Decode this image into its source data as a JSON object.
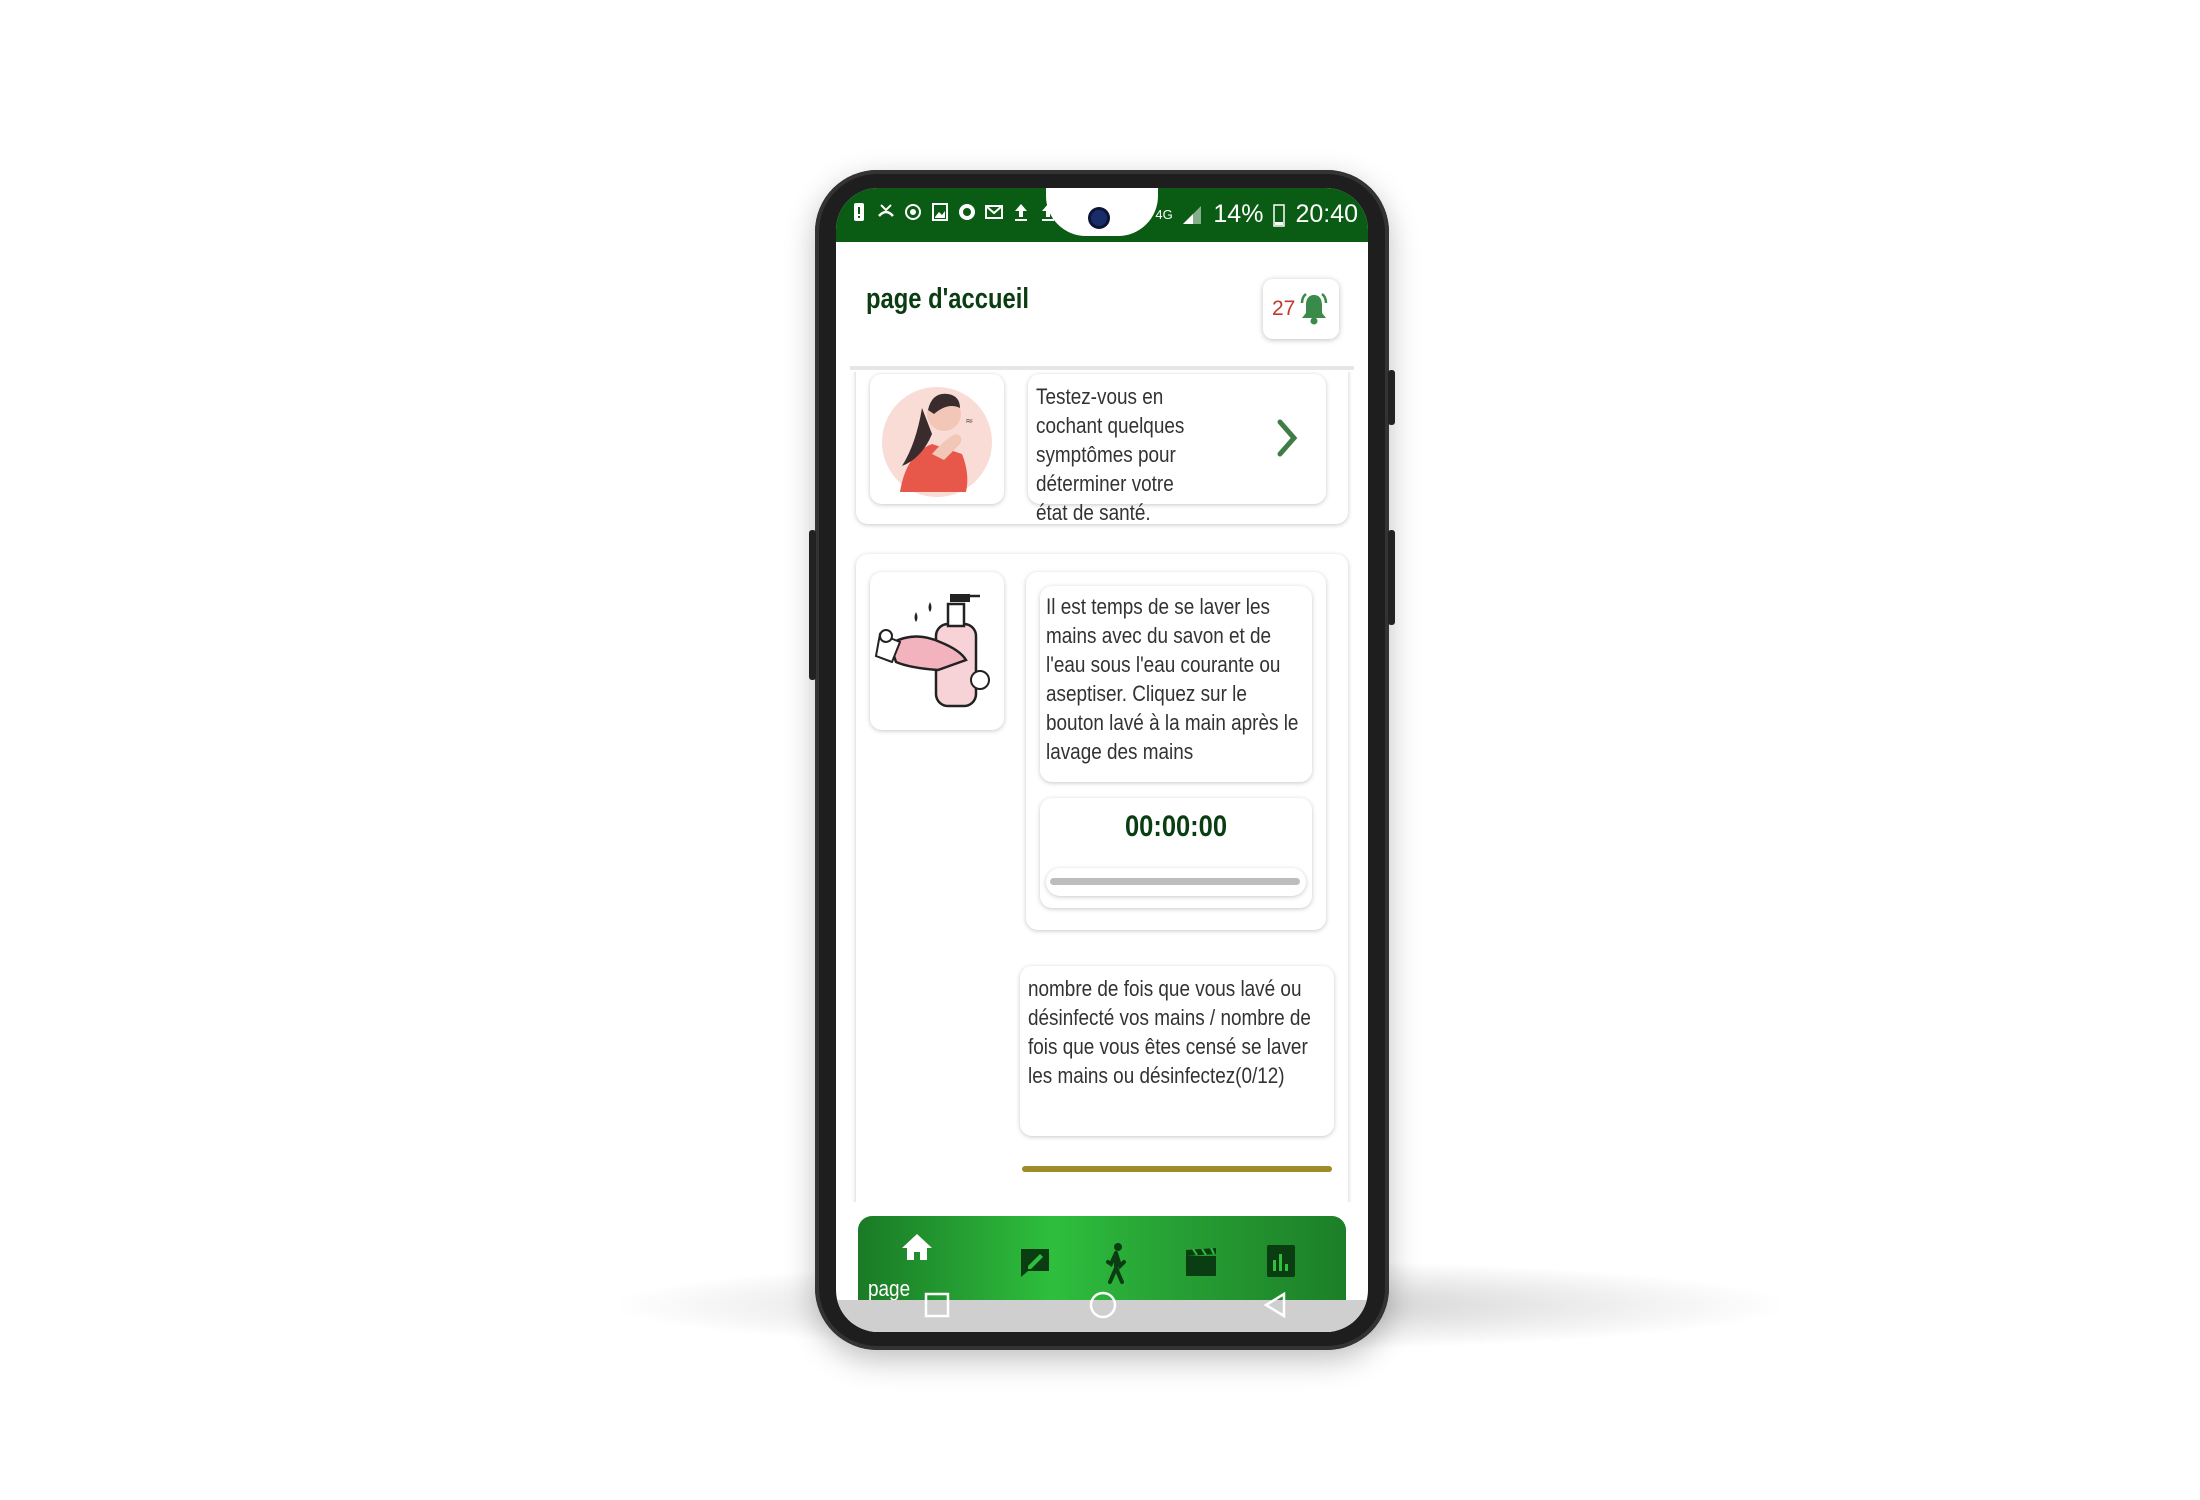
{
  "status_bar": {
    "battery": "14%",
    "time": "20:40",
    "network": "4G",
    "icons": [
      "alert-icon",
      "missed-call-icon",
      "sync-icon",
      "gallery-icon",
      "whatsapp-icon",
      "mail-icon",
      "upload-icon",
      "upload-icon",
      "location-icon",
      "signal-icon",
      "battery-icon"
    ]
  },
  "header": {
    "title": "page d'accueil",
    "notification_count": "27",
    "icon": "bell-ringing-icon"
  },
  "symptom_card": {
    "text": "Testez-vous en cochant quelques symptômes pour déterminer votre état de santé.",
    "icon": "chevron-right-icon",
    "image": "coughing-woman-illustration"
  },
  "handwash_card": {
    "text": "Il est temps de se laver les mains avec du savon et de l'eau sous l'eau courante ou aseptiser. Cliquez sur le bouton lavé à la main après le lavage des mains",
    "timer": "00:00:00",
    "progress": 0,
    "image": "handwashing-soap-illustration",
    "count_text": "nombre de fois que vous lavé ou désinfecté vos mains / nombre de fois que vous êtes censé se laver les mains ou désinfectez(0/12)"
  },
  "bottom_nav": {
    "items": [
      {
        "icon": "home-icon",
        "label": "page d'accueil",
        "active": true
      },
      {
        "icon": "edit-note-icon"
      },
      {
        "icon": "walking-person-icon"
      },
      {
        "icon": "clapperboard-icon"
      },
      {
        "icon": "bar-chart-icon"
      }
    ]
  },
  "system_nav": {
    "icons": [
      "recents-square-icon",
      "home-circle-icon",
      "back-triangle-icon"
    ]
  },
  "colors": {
    "brand_green": "#0a5c14",
    "nav_green": "#2ebf3d",
    "title_green": "#0b3d13",
    "badge_red": "#c0392b"
  }
}
